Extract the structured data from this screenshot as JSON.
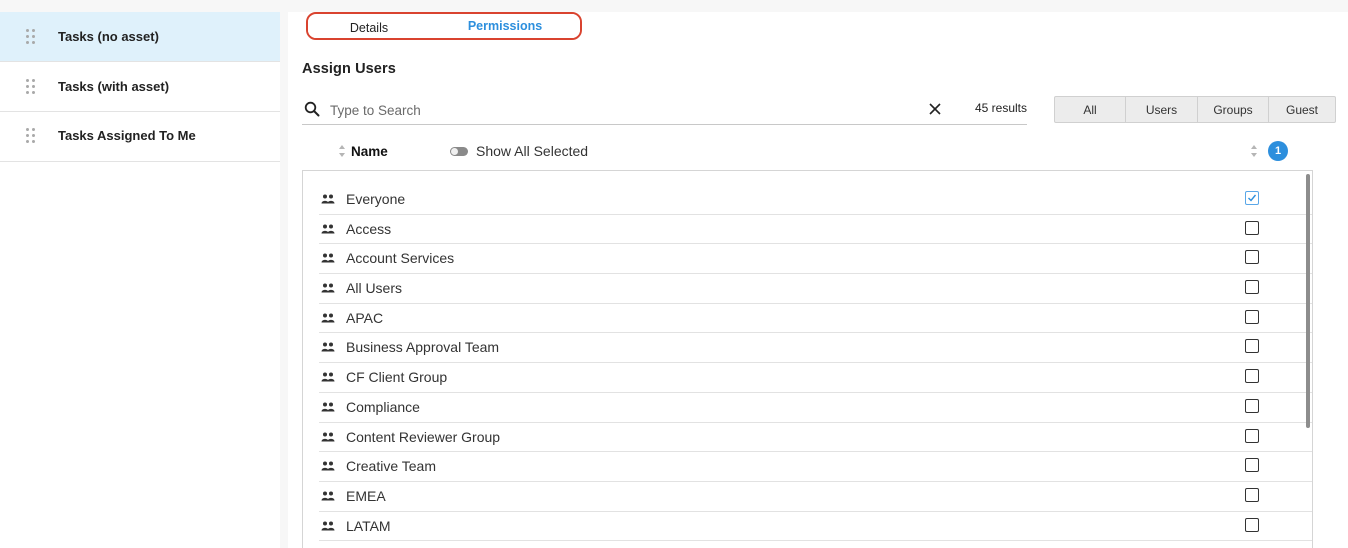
{
  "sidebar": {
    "items": [
      {
        "label": "Tasks (no asset)",
        "active": true
      },
      {
        "label": "Tasks (with asset)",
        "active": false
      },
      {
        "label": "Tasks Assigned To Me",
        "active": false
      }
    ]
  },
  "tabs": {
    "details": "Details",
    "permissions": "Permissions"
  },
  "section_title": "Assign Users",
  "search": {
    "placeholder": "Type to Search",
    "value": "",
    "results": "45 results"
  },
  "filters": [
    "All",
    "Users",
    "Groups",
    "Guest"
  ],
  "list_header": {
    "name": "Name",
    "show_all_selected": "Show All Selected",
    "selected_count": "1"
  },
  "rows": [
    {
      "name": "Everyone",
      "checked": true
    },
    {
      "name": "Access",
      "checked": false
    },
    {
      "name": "Account Services",
      "checked": false
    },
    {
      "name": "All Users",
      "checked": false
    },
    {
      "name": "APAC",
      "checked": false
    },
    {
      "name": "Business Approval Team",
      "checked": false
    },
    {
      "name": "CF Client Group",
      "checked": false
    },
    {
      "name": "Compliance",
      "checked": false
    },
    {
      "name": "Content Reviewer Group",
      "checked": false
    },
    {
      "name": "Creative Team",
      "checked": false
    },
    {
      "name": "EMEA",
      "checked": false
    },
    {
      "name": "LATAM",
      "checked": false
    }
  ],
  "colors": {
    "accent": "#2d8fdd",
    "highlight_border": "#d9432f",
    "sidebar_active": "#dff1fb"
  }
}
